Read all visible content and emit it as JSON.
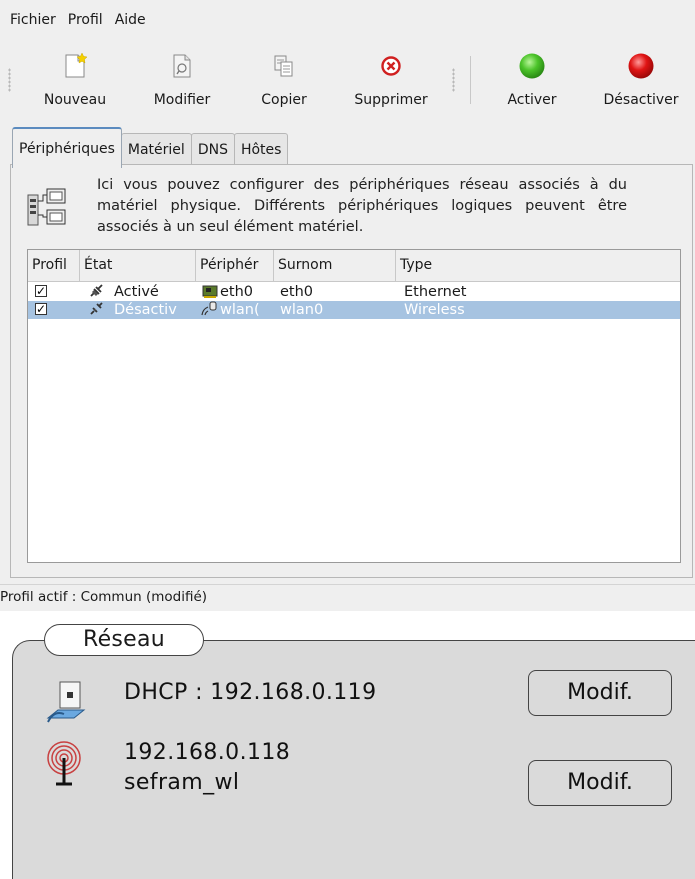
{
  "menu": [
    "Fichier",
    "Profil",
    "Aide"
  ],
  "toolbar": {
    "nouveau": "Nouveau",
    "modifier": "Modifier",
    "copier": "Copier",
    "supprimer": "Supprimer",
    "activer": "Activer",
    "desactiver": "Désactiver"
  },
  "tabs": [
    "Périphériques",
    "Matériel",
    "DNS",
    "Hôtes"
  ],
  "info_text": "Ici vous pouvez configurer des périphériques réseau associés à du matériel physique. Différents périphériques logiques peuvent être associés à un seul élément matériel.",
  "table": {
    "columns": [
      "Profil",
      "État",
      "Périphér",
      "Surnom",
      "Type"
    ],
    "rows": [
      {
        "checked": true,
        "state": "Activé",
        "device": "eth0",
        "nickname": "eth0",
        "type": "Ethernet",
        "selected": false
      },
      {
        "checked": true,
        "state": "Désactiv",
        "device": "wlan(",
        "nickname": "wlan0",
        "type": "Wireless",
        "selected": true
      }
    ]
  },
  "status": "Profil actif : Commun (modifié)",
  "network": {
    "legend": "Réseau",
    "dhcp_line": "DHCP : 192.168.0.119",
    "wifi_ip": "192.168.0.118",
    "wifi_ssid": "sefram_wl",
    "modif_label_1": "Modif.",
    "modif_label_2": "Modif."
  },
  "colors": {
    "selection": "#a6c3e1",
    "activate": "#39b01f",
    "deactivate": "#d90f0f",
    "delete": "#d02020"
  }
}
